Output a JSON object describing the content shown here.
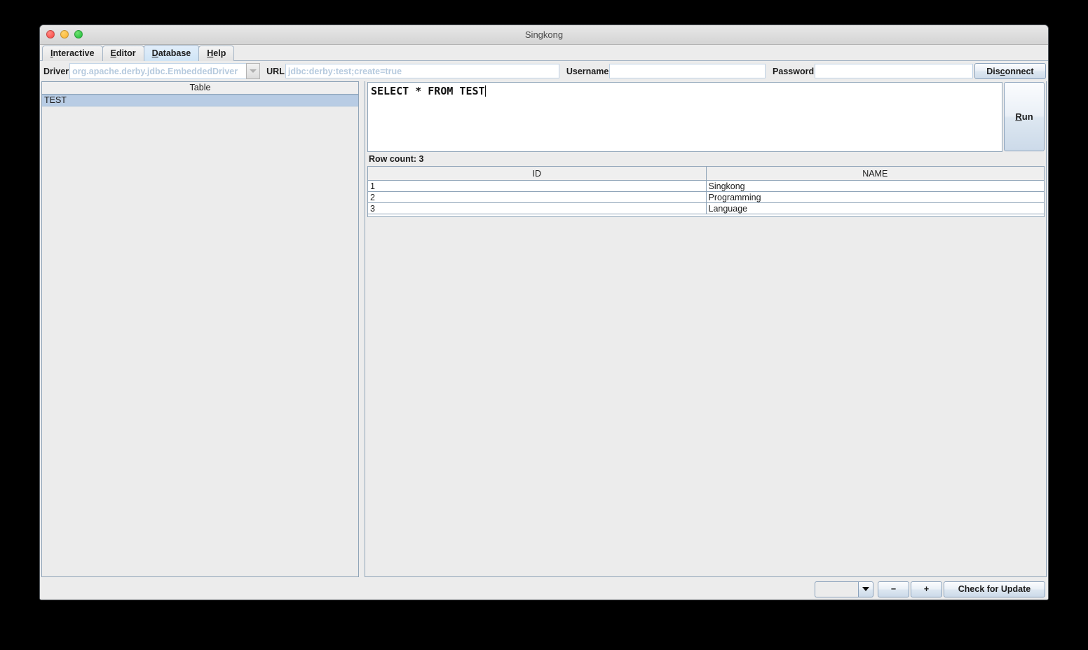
{
  "window": {
    "title": "Singkong",
    "controls": {
      "close": "close-button",
      "minimize": "minimize-button",
      "maximize": "maximize-button"
    }
  },
  "tabs": [
    {
      "label": "Interactive",
      "mnemonic": "I",
      "active": false
    },
    {
      "label": "Editor",
      "mnemonic": "E",
      "active": false
    },
    {
      "label": "Database",
      "mnemonic": "D",
      "active": true
    },
    {
      "label": "Help",
      "mnemonic": "H",
      "active": false
    }
  ],
  "connection_bar": {
    "driver_label": "Driver",
    "driver_value": "",
    "driver_placeholder": "org.apache.derby.jdbc.EmbeddedDriver",
    "url_label": "URL",
    "url_value": "",
    "url_placeholder": "jdbc:derby:test;create=true",
    "username_label": "Username",
    "username_value": "",
    "password_label": "Password",
    "password_value": "",
    "disconnect_label": "Disconnect",
    "disconnect_mnemonic": "c"
  },
  "left_panel": {
    "column_header": "Table",
    "rows": [
      {
        "name": "TEST",
        "selected": true
      }
    ],
    "selection_color": "#b8cce4"
  },
  "editor": {
    "sql": "SELECT * FROM TEST",
    "run_label": "Run",
    "run_mnemonic": "R"
  },
  "results": {
    "row_count_label": "Row count: 3",
    "columns": [
      "ID",
      "NAME"
    ],
    "rows": [
      [
        "1",
        "Singkong"
      ],
      [
        "2",
        "Programming"
      ],
      [
        "3",
        "Language"
      ]
    ]
  },
  "status_bar": {
    "combo_value": "",
    "decrease_label": "−",
    "increase_label": "+",
    "check_update_label": "Check for Update"
  }
}
